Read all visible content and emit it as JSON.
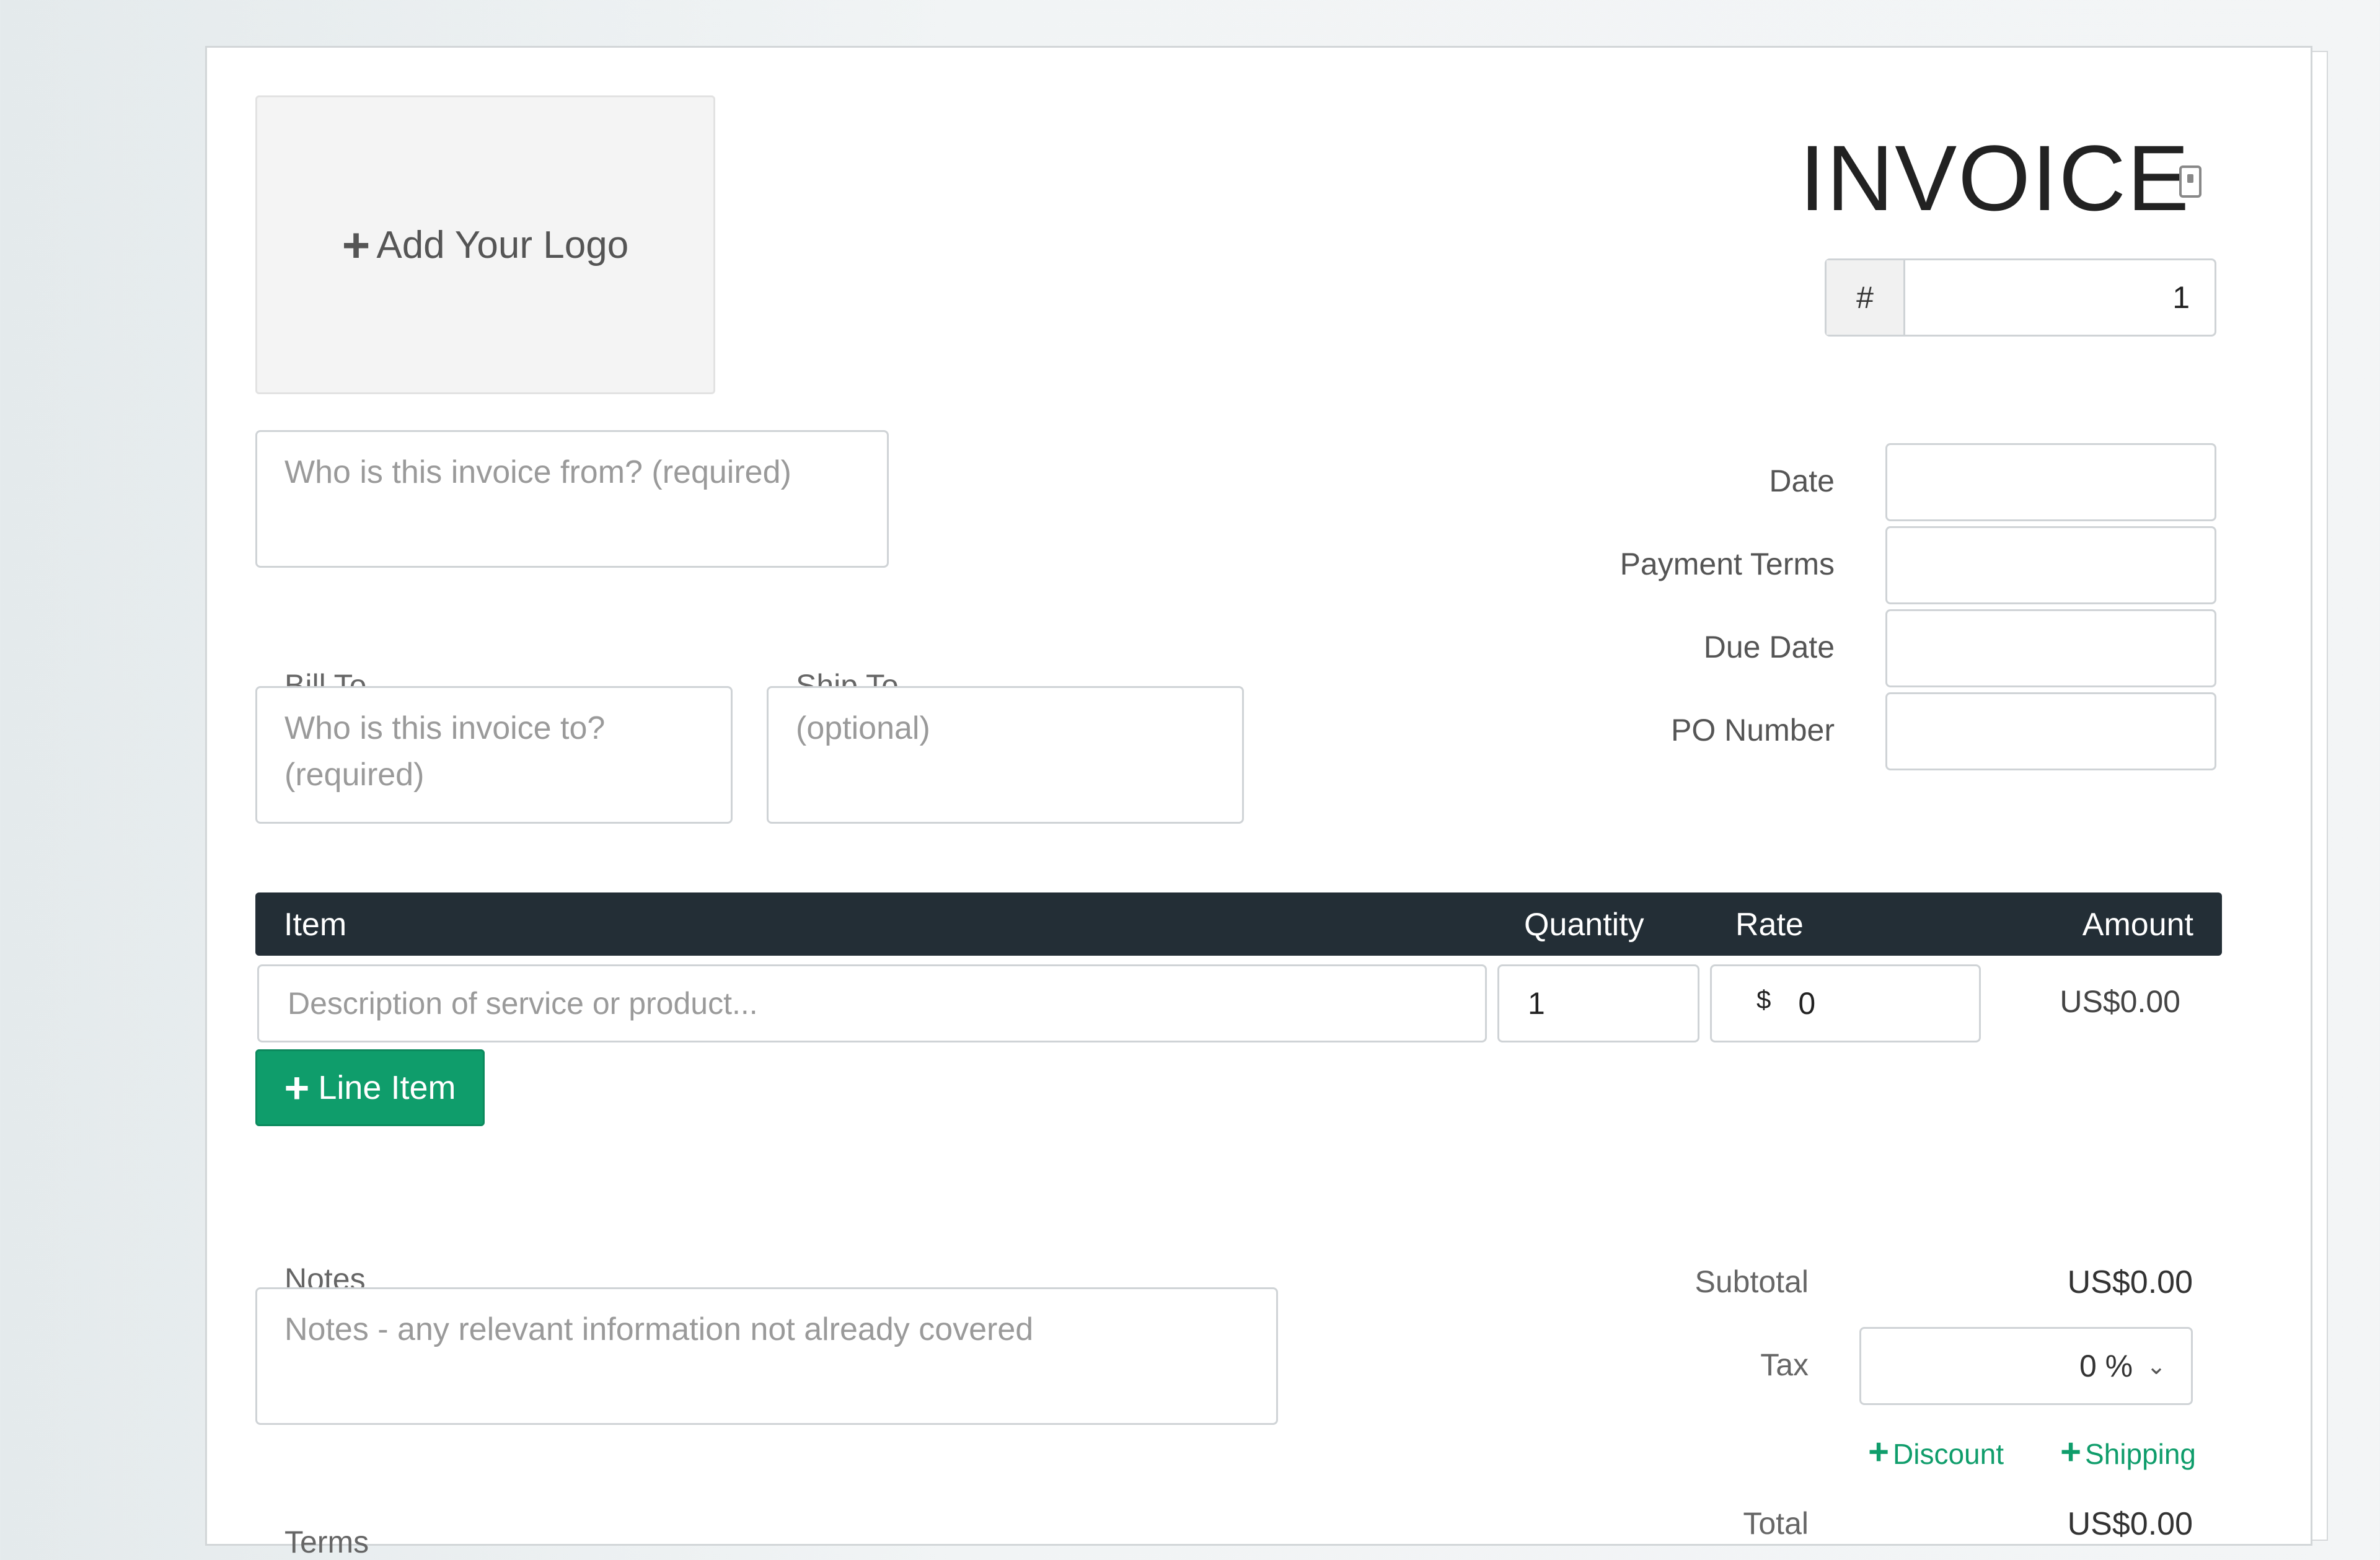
{
  "header": {
    "add_logo_label": "Add Your Logo",
    "title": "INVOICE",
    "number_prefix": "#",
    "number_value": "1"
  },
  "from": {
    "placeholder": "Who is this invoice from? (required)"
  },
  "bill_to": {
    "label": "Bill To",
    "placeholder": "Who is this invoice to? (required)"
  },
  "ship_to": {
    "label": "Ship To",
    "placeholder": "(optional)"
  },
  "meta": {
    "date_label": "Date",
    "payment_terms_label": "Payment Terms",
    "due_date_label": "Due Date",
    "po_number_label": "PO Number"
  },
  "table": {
    "headers": {
      "item": "Item",
      "quantity": "Quantity",
      "rate": "Rate",
      "amount": "Amount"
    },
    "row": {
      "description_placeholder": "Description of service or product...",
      "quantity": "1",
      "currency_symbol": "$",
      "rate": "0",
      "amount": "US$0.00"
    },
    "add_line_item_label": "Line Item"
  },
  "notes": {
    "label": "Notes",
    "placeholder": "Notes - any relevant information not already covered"
  },
  "terms": {
    "label": "Terms"
  },
  "summary": {
    "subtotal_label": "Subtotal",
    "subtotal_value": "US$0.00",
    "tax_label": "Tax",
    "tax_value": "0 %",
    "discount_label": "Discount",
    "shipping_label": "Shipping",
    "total_label": "Total",
    "total_value": "US$0.00"
  },
  "colors": {
    "accent_green": "#0f9d6b",
    "table_header": "#232e36"
  }
}
